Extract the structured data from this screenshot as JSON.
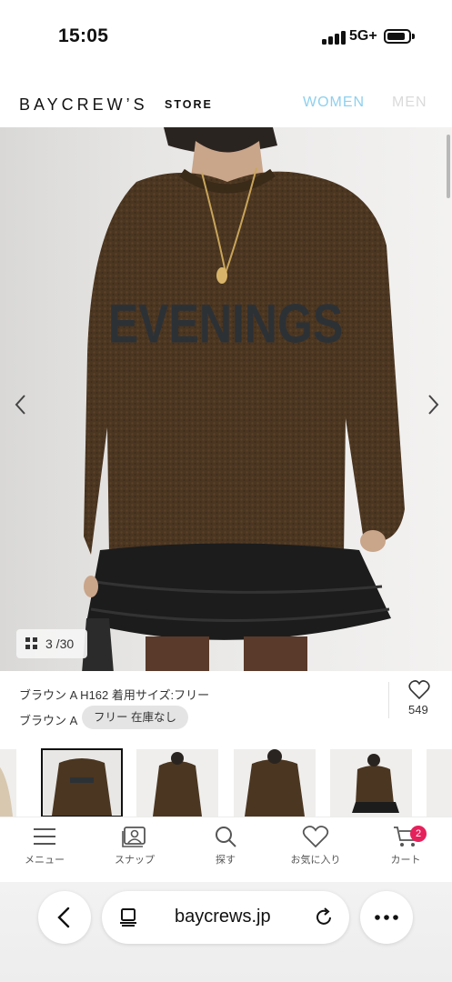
{
  "status_bar": {
    "time": "15:05",
    "network": "5G+",
    "icons": [
      "signal-icon",
      "battery-icon"
    ]
  },
  "header": {
    "logo": "BAYCREW’S",
    "logo_suffix": "STORE",
    "nav": [
      {
        "label": "WOMEN",
        "color": "#8fd0ee"
      },
      {
        "label": "MEN",
        "color": "#dadada"
      }
    ]
  },
  "product_image": {
    "counter": "3 /30",
    "prev_icon": "chevron-left-icon",
    "next_icon": "chevron-right-icon",
    "sweater_text": "EVENINGS"
  },
  "product_info": {
    "spec": "ブラウン A H162 着用サイズ:フリー",
    "color": "ブラウン A",
    "size_stock": "フリー 在庫なし",
    "favorite_count": "549"
  },
  "thumbnails": {
    "selected_index": 1,
    "count_visible": 6
  },
  "bottom_nav": {
    "items": [
      {
        "label": "メニュー",
        "icon": "menu-icon"
      },
      {
        "label": "スナップ",
        "icon": "snap-icon"
      },
      {
        "label": "探す",
        "icon": "search-icon"
      },
      {
        "label": "お気に入り",
        "icon": "heart-icon"
      },
      {
        "label": "カート",
        "icon": "cart-icon"
      }
    ],
    "cart_badge": "2",
    "badge_color": "#e5215b"
  },
  "browser": {
    "url": "baycrews.jp",
    "icons": [
      "back-icon",
      "page-icon",
      "reload-icon",
      "more-icon"
    ]
  }
}
